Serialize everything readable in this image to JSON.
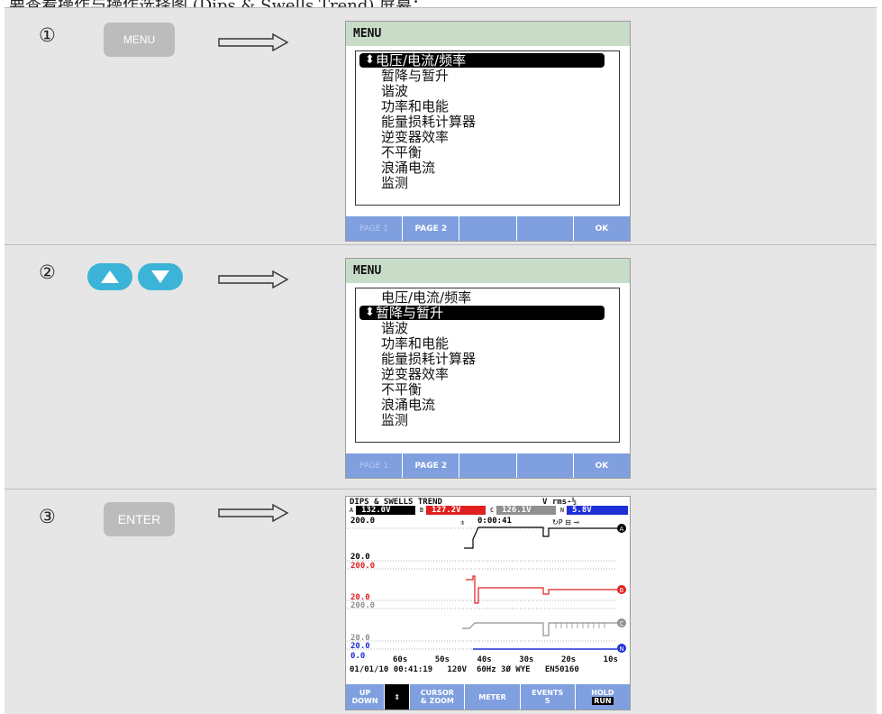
{
  "caption": "要查看操作与操作选择图 (Dips & Swells Trend) 屏幕：",
  "steps": [
    {
      "number": "①",
      "key": "MENU"
    },
    {
      "number": "②",
      "key": "▲ ▼"
    },
    {
      "number": "③",
      "key": "ENTER"
    }
  ],
  "menu": {
    "title": "MENU",
    "items": [
      "电压/电流/频率",
      "暂降与暂升",
      "谐波",
      "功率和电能",
      "能量损耗计算器",
      "逆变器效率",
      "不平衡",
      "浪涌电流",
      "监测"
    ],
    "selected_step1": 0,
    "selected_step2": 1,
    "softkeys": [
      "PAGE 1",
      "PAGE 2",
      "",
      "",
      "OK"
    ]
  },
  "trend": {
    "title": "DIPS & SWELLS TREND",
    "unit": "V rms-½",
    "phases": [
      {
        "tag": "A",
        "value": "132.0V",
        "color": "#000000"
      },
      {
        "tag": "B",
        "value": "127.2V",
        "color": "#e02020"
      },
      {
        "tag": "C",
        "value": "126.1V",
        "color": "#909090"
      },
      {
        "tag": "N",
        "value": "5.8V",
        "color": "#1e2fd6"
      }
    ],
    "y_labels": [
      {
        "text": "200.0",
        "color": "#000000"
      },
      {
        "text": "20.0",
        "color": "#000000"
      },
      {
        "text": "200.0",
        "color": "#e02020"
      },
      {
        "text": "20.0",
        "color": "#e02020"
      },
      {
        "text": "200.0",
        "color": "#909090"
      },
      {
        "text": "20.0",
        "color": "#909090"
      },
      {
        "text": "20.0",
        "color": "#1e2fd6"
      },
      {
        "text": "0.0",
        "color": "#1e2fd6"
      }
    ],
    "timer": "0:00:41",
    "x_ticks": [
      "60s",
      "50s",
      "40s",
      "30s",
      "20s",
      "10s"
    ],
    "status_date": "01/01/10",
    "status_time": "00:41:19",
    "status_voltage": "120V",
    "status_freq": "60Hz",
    "status_config": "3Ø WYE",
    "status_std": "EN50160",
    "softkeys": [
      {
        "line1": "UP",
        "line2": "DOWN"
      },
      {
        "line1": "⇕",
        "line2": ""
      },
      {
        "line1": "CURSOR",
        "line2": "& ZOOM"
      },
      {
        "line1": "METER",
        "line2": ""
      },
      {
        "line1": "EVENTS",
        "line2": "5"
      },
      {
        "line1": "HOLD",
        "line2": "RUN"
      }
    ]
  }
}
